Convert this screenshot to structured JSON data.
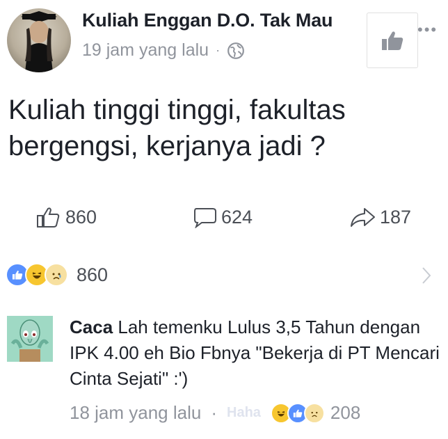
{
  "post": {
    "page_name": "Kuliah Enggan D.O. Tak Mau",
    "timestamp": "19 jam yang lalu",
    "separator": "·",
    "text": "Kuliah tinggi tinggi, fakultas bergengsi, kerjanya jadi ?"
  },
  "actions": {
    "like_count": "860",
    "comment_count": "624",
    "share_count": "187"
  },
  "reactions": {
    "total": "860"
  },
  "comment": {
    "author": "Caca",
    "text": "Lah temenku Lulus 3,5 Tahun dengan IPK 4.00 eh Bio Fbnya \"Bekerja di PT Mencari Cinta Sejati\" :')",
    "timestamp": "18 jam yang lalu",
    "separator": "·",
    "reaction_label": "Haha",
    "reaction_count": "208"
  },
  "colors": {
    "text": "#1d2129",
    "muted": "#90949c",
    "like_blue": "#5890ff",
    "emoji_yellow": "#f7c62f"
  }
}
